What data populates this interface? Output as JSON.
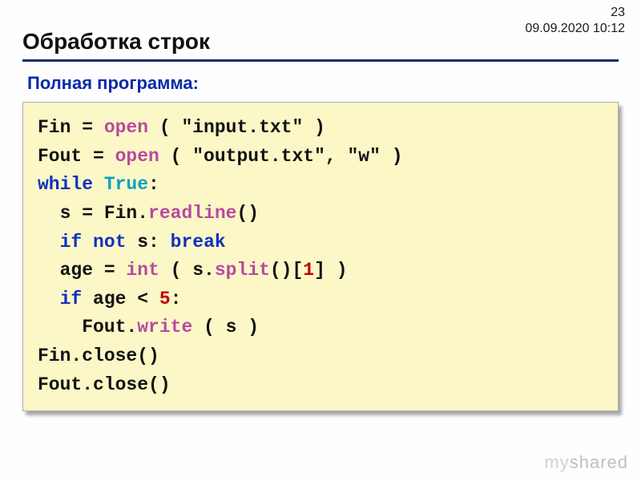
{
  "meta": {
    "page_number": "23",
    "datetime": "09.09.2020 10:12"
  },
  "title": "Обработка строк",
  "subtitle": "Полная программа:",
  "code": {
    "l1_a": "Fin = ",
    "l1_open": "open",
    "l1_b": " ( \"input.txt\" )",
    "l2_a": "Fout = ",
    "l2_open": "open",
    "l2_b": " ( \"output.txt\", \"w\" )",
    "l3_while": "while",
    "l3_sp": " ",
    "l3_true": "True",
    "l3_colon": ":",
    "l4_a": "  s = Fin.",
    "l4_readline": "readline",
    "l4_b": "()",
    "l5_a": "  ",
    "l5_if": "if",
    "l5_sp": " ",
    "l5_not": "not",
    "l5_b": " s: ",
    "l5_break": "break",
    "l6_a": "  age = ",
    "l6_int": "int",
    "l6_b": " ( s.",
    "l6_split": "split",
    "l6_c": "()[",
    "l6_one": "1",
    "l6_d": "] )",
    "l7_a": "  ",
    "l7_if": "if",
    "l7_b": " age < ",
    "l7_five": "5",
    "l7_colon": ":",
    "l8_a": "    Fout.",
    "l8_write": "write",
    "l8_b": " ( s )",
    "l9": "Fin.close()",
    "l10": "Fout.close()"
  },
  "watermark": {
    "my": "my",
    "shared": "shared"
  }
}
